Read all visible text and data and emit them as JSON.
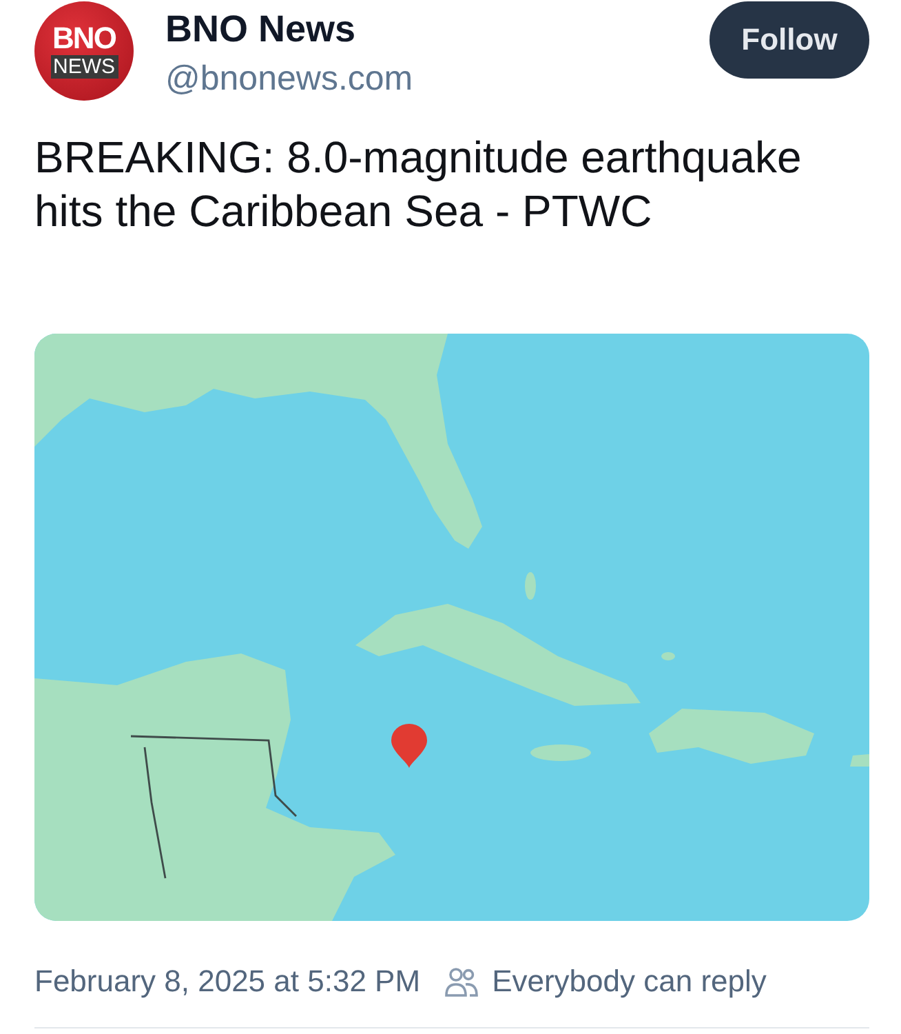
{
  "post": {
    "author": {
      "avatar_logo": [
        "BNO",
        "NEWS"
      ],
      "name": "BNO News",
      "handle": "@bnonews.com"
    },
    "follow_button": {
      "label": "Follow"
    },
    "text": "BREAKING: 8.0-magnitude earthquake hits the Caribbean Sea - PTWC",
    "media": {
      "kind": "map"
    },
    "footer": {
      "timestamp": "February 8, 2025 at 5:32 PM",
      "reply_setting": "Everybody can reply"
    }
  }
}
